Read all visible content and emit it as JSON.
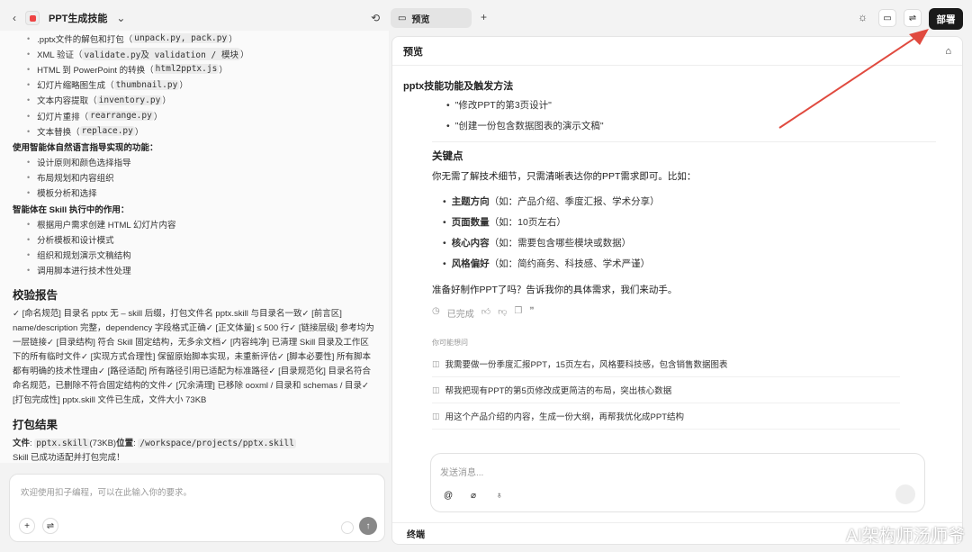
{
  "header": {
    "title": "PPT生成技能"
  },
  "left": {
    "script_items": [
      ".pptx文件的解包和打包（unpack.py, pack.py）",
      "XML 验证（validate.py及 validation / 模块）",
      "HTML 到 PowerPoint 的转换（html2pptx.js）",
      "幻灯片缩略图生成（thumbnail.py）",
      "文本内容提取（inventory.py）",
      "幻灯片重排（rearrange.py）",
      "文本替换（replace.py）"
    ],
    "nl_heading": "使用智能体自然语言指导实现的功能：",
    "nl_items": [
      "设计原则和颜色选择指导",
      "布局规划和内容组织",
      "模板分析和选择"
    ],
    "agent_heading": "智能体在 Skill 执行中的作用：",
    "agent_items": [
      "根据用户需求创建 HTML 幻灯片内容",
      "分析模板和设计模式",
      "组织和规划演示文稿结构",
      "调用脚本进行技术性处理"
    ],
    "report_title": "校验报告",
    "report_text": "✓ [命名规范] 目录名 pptx 无 – skill 后缀，打包文件名 pptx.skill 与目录名一致✓ [前言区] name/description 完整，dependency 字段格式正确✓ [正文体量] ≤ 500 行✓ [链接层级] 参考均为一层链接✓ [目录结构] 符合 Skill 固定结构，无多余文档✓ [内容纯净] 已清理 Skill 目录及工作区下的所有临时文件✓ [实现方式合理性] 保留原始脚本实现，未重新评估✓ [脚本必要性] 所有脚本都有明确的技术性理由✓ [路径适配] 所有路径引用已适配为标准路径✓ [目录规范化] 目录名符合命名规范，已删除不符合固定结构的文件✓ [冗余清理] 已移除 ooxml / 目录和 schemas / 目录✓ [打包完成性] pptx.skill 文件已生成，文件大小 73KB",
    "pack_title": "打包结果",
    "file_label": "文件",
    "file_name": "pptx.skill",
    "file_size": "(73KB)",
    "location_label": "位置",
    "location": "/workspace/projects/pptx.skill",
    "done_text": "Skill 已成功适配并打包完成！",
    "input_placeholder": "欢迎使用扣子编程，可以在此输入你的要求。"
  },
  "right": {
    "tab_label": "预览",
    "deploy_label": "部署",
    "preview_title": "预览",
    "section_title": "pptx技能功能及触发方法",
    "examples": [
      "\"修改PPT的第3页设计\"",
      "\"创建一份包含数据图表的演示文稿\""
    ],
    "key_title": "关键点",
    "key_intro": "你无需了解技术细节，只需清晰表达你的PPT需求即可。比如：",
    "key_items": [
      {
        "b": "主题方向",
        "t": "（如：产品介绍、季度汇报、学术分享）"
      },
      {
        "b": "页面数量",
        "t": "（如：10页左右）"
      },
      {
        "b": "核心内容",
        "t": "（如：需要包含哪些模块或数据）"
      },
      {
        "b": "风格偏好",
        "t": "（如：简约商务、科技感、学术严谨）"
      }
    ],
    "closing": "准备好制作PPT了吗？告诉我你的具体需求，我们来动手。",
    "status": "已完成",
    "suggest_title": "你可能想问",
    "suggestions": [
      "我需要做一份季度汇报PPT，15页左右，风格要科技感，包含销售数据图表",
      "帮我把现有PPT的第5页修改成更简洁的布局，突出核心数据",
      "用这个产品介绍的内容，生成一份大纲，再帮我优化成PPT结构"
    ],
    "input_placeholder": "发送消息...",
    "terminal": "终端"
  },
  "watermark": "AI架构师汤师爷"
}
